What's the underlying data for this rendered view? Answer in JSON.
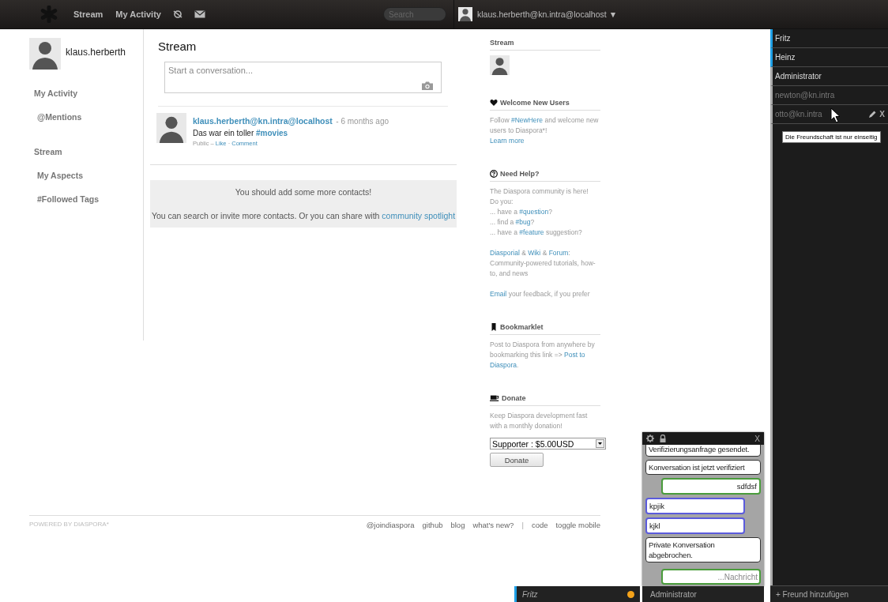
{
  "top_bar": {
    "nav": [
      {
        "label": "Stream"
      },
      {
        "label": "My Activity"
      }
    ],
    "search": {
      "placeholder": "Search"
    },
    "user": {
      "name": "klaus.herberth@kn.intra@localhost",
      "caret": "▼"
    }
  },
  "profile": {
    "name": "klaus.herberth"
  },
  "left_nav": [
    {
      "label": "My Activity",
      "kind": "heading"
    },
    {
      "label": "@Mentions",
      "kind": "sub"
    },
    {
      "label": "Stream",
      "kind": "heading"
    },
    {
      "label": "My Aspects",
      "kind": "sub"
    },
    {
      "label": "#Followed Tags",
      "kind": "sub"
    }
  ],
  "stream": {
    "title": "Stream",
    "publisher": {
      "placeholder": "Start a conversation..."
    },
    "posts": [
      {
        "author": "klaus.herberth@kn.intra@localhost",
        "time": "- 6 months ago",
        "text": [
          {
            "text": "Das war ein toller "
          },
          {
            "text": "#movies",
            "link": true
          }
        ],
        "meta": [
          {
            "text": "Public – "
          },
          {
            "text": "Like",
            "link": true
          },
          {
            "text": " · "
          },
          {
            "text": "Comment",
            "link": true
          }
        ]
      }
    ],
    "notice": {
      "title": "You should add some more contacts!",
      "text": [
        {
          "text": "You can search or invite more contacts. Or you can share with "
        },
        {
          "text": "community spotlight",
          "link": true
        }
      ]
    }
  },
  "sidebar": [
    {
      "kind": "stream",
      "title": "Stream"
    },
    {
      "kind": "welcome",
      "title": "Welcome New Users",
      "blocks": [
        [
          [
            {
              "text": "Follow "
            },
            {
              "text": "#NewHere",
              "link": true
            },
            {
              "text": " and welcome new users to Diaspora*!"
            }
          ],
          [
            {
              "text": "Learn more",
              "link": true
            }
          ]
        ]
      ]
    },
    {
      "kind": "help",
      "title": "Need Help?",
      "blocks": [
        [
          [
            {
              "text": "The Diaspora community is here!"
            }
          ],
          [
            {
              "text": "Do you:"
            }
          ],
          [
            {
              "text": "... have a "
            },
            {
              "text": "#question",
              "link": true
            },
            {
              "text": "?"
            }
          ],
          [
            {
              "text": "... find a "
            },
            {
              "text": "#bug",
              "link": true
            },
            {
              "text": "?"
            }
          ],
          [
            {
              "text": "... have a "
            },
            {
              "text": "#feature",
              "link": true
            },
            {
              "text": " suggestion?"
            }
          ]
        ],
        [
          [
            {
              "text": "Diasporial",
              "link": true
            },
            {
              "text": " & "
            },
            {
              "text": "Wiki",
              "link": true
            },
            {
              "text": " & "
            },
            {
              "text": "Forum",
              "link": true
            },
            {
              "text": ":"
            }
          ],
          [
            {
              "text": "Community-powered tutorials, how-to, and news"
            }
          ]
        ],
        [
          [
            {
              "text": "Email",
              "link": true
            },
            {
              "text": " your feedback, if you prefer"
            }
          ]
        ]
      ]
    },
    {
      "kind": "bookmarklet",
      "title": "Bookmarklet",
      "blocks": [
        [
          [
            {
              "text": "Post to Diaspora from anywhere by"
            }
          ],
          [
            {
              "text": "bookmarking this link => "
            },
            {
              "text": "Post to",
              "link": true
            }
          ],
          [
            {
              "text": "Diaspora",
              "link": true
            },
            {
              "text": "."
            }
          ]
        ]
      ]
    },
    {
      "kind": "donate",
      "title": "Donate",
      "blocks": [
        [
          [
            {
              "text": "Keep Diaspora development fast with a monthly donation!"
            }
          ]
        ]
      ],
      "select": {
        "value": "Supporter : $5.00USD"
      },
      "button": "Donate"
    }
  ],
  "footer": {
    "powered": "POWERED BY DIASPORA*",
    "links": [
      {
        "label": "@joindiaspora",
        "kind": "link"
      },
      {
        "label": "github",
        "kind": "link"
      },
      {
        "label": "blog",
        "kind": "link"
      },
      {
        "label": "what's new?",
        "kind": "link"
      },
      {
        "label": "|",
        "kind": "separator"
      },
      {
        "label": "code",
        "kind": "link"
      },
      {
        "label": "toggle mobile",
        "kind": "link"
      }
    ]
  },
  "roster": {
    "contacts": [
      {
        "name": "Fritz",
        "highlighted": true,
        "offline": false,
        "hovered": false
      },
      {
        "name": "Heinz",
        "highlighted": true,
        "offline": false,
        "hovered": false
      },
      {
        "name": "Administrator",
        "highlighted": false,
        "offline": false,
        "hovered": false
      },
      {
        "name": "newton@kn.intra",
        "highlighted": false,
        "offline": true,
        "hovered": false
      },
      {
        "name": "otto@kn.intra",
        "highlighted": false,
        "offline": true,
        "hovered": true,
        "remove": "X",
        "tooltip": "Die Freundschaft ist nur einseitig"
      }
    ],
    "add": "+ Freund hinzufügen"
  },
  "chat": {
    "close": "X",
    "messages": [
      {
        "kind": "system",
        "text": "Verifizierungsanfrage gesendet."
      },
      {
        "kind": "system",
        "text": "Konversation ist jetzt verifiziert"
      },
      {
        "kind": "own",
        "text": "sdfdsf"
      },
      {
        "kind": "other",
        "text": "kpjik"
      },
      {
        "kind": "other",
        "text": "kjkl"
      },
      {
        "kind": "system",
        "text": "Private Konversation abgebrochen."
      }
    ],
    "input": {
      "placeholder": "...Nachricht"
    },
    "tabs": [
      {
        "label": "Fritz",
        "unread": true
      },
      {
        "label": "Administrator",
        "unread": false
      }
    ]
  }
}
